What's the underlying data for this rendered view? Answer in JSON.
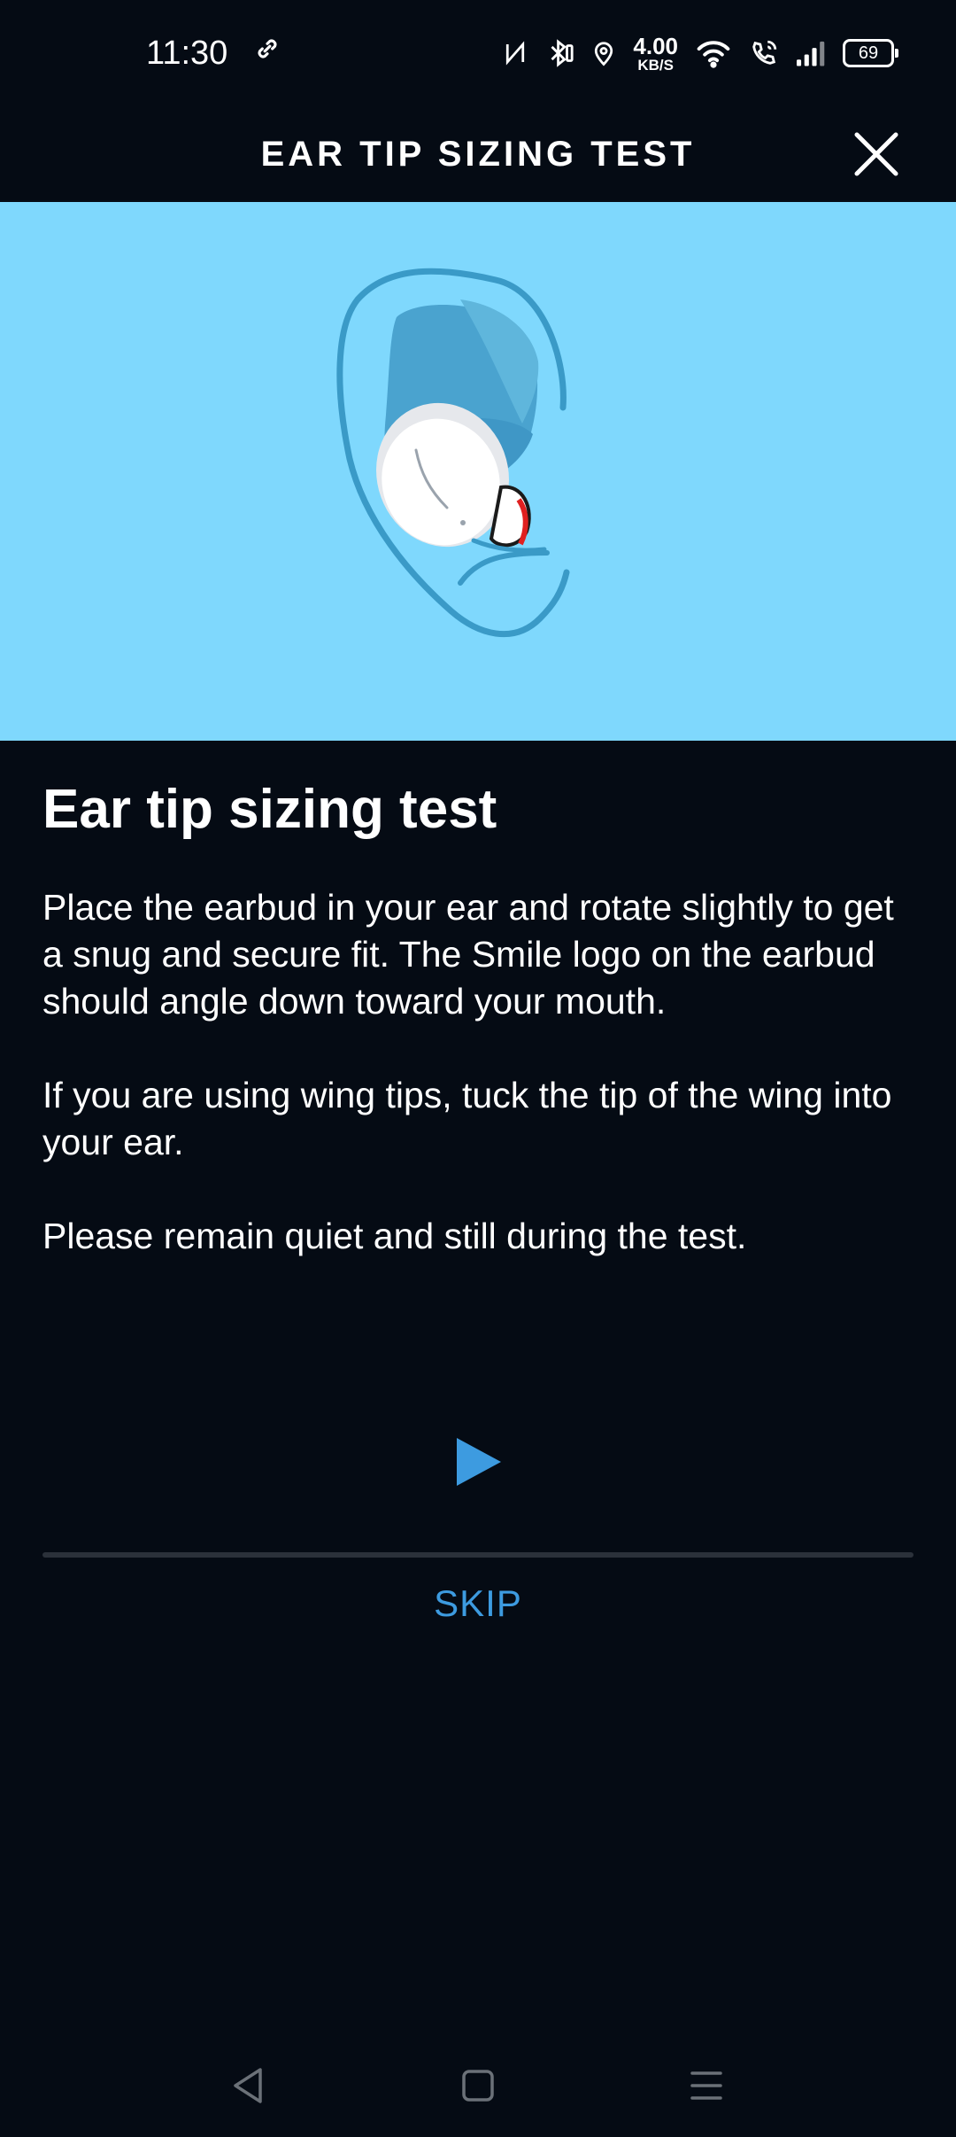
{
  "status_bar": {
    "time": "11:30",
    "net_speed_value": "4.00",
    "net_speed_unit": "KB/S",
    "battery": "69",
    "icons": [
      "link-icon",
      "nfc-icon",
      "bluetooth-icon",
      "location-icon",
      "wifi-icon",
      "volte-call-icon",
      "signal-icon",
      "battery-icon"
    ]
  },
  "header": {
    "title": "EAR TIP SIZING TEST",
    "close_icon": "close-icon"
  },
  "hero": {
    "image": "ear-with-earbud-illustration",
    "background": "#7fd8fd"
  },
  "main": {
    "title": "Ear tip sizing test",
    "paragraphs": [
      "Place the earbud in your ear and rotate slightly to get a snug and secure fit. The Smile logo on the earbud should angle down toward your mouth.",
      "If you are using wing tips, tuck the tip of the wing into your ear.",
      "Please remain quiet and still during the test."
    ]
  },
  "player": {
    "play_icon": "play-icon",
    "progress": 0
  },
  "actions": {
    "skip_label": "SKIP"
  },
  "colors": {
    "accent": "#3d9be0",
    "background": "#050b14"
  },
  "nav_bar": {
    "icons": [
      "back-icon",
      "home-icon",
      "menu-icon"
    ]
  }
}
